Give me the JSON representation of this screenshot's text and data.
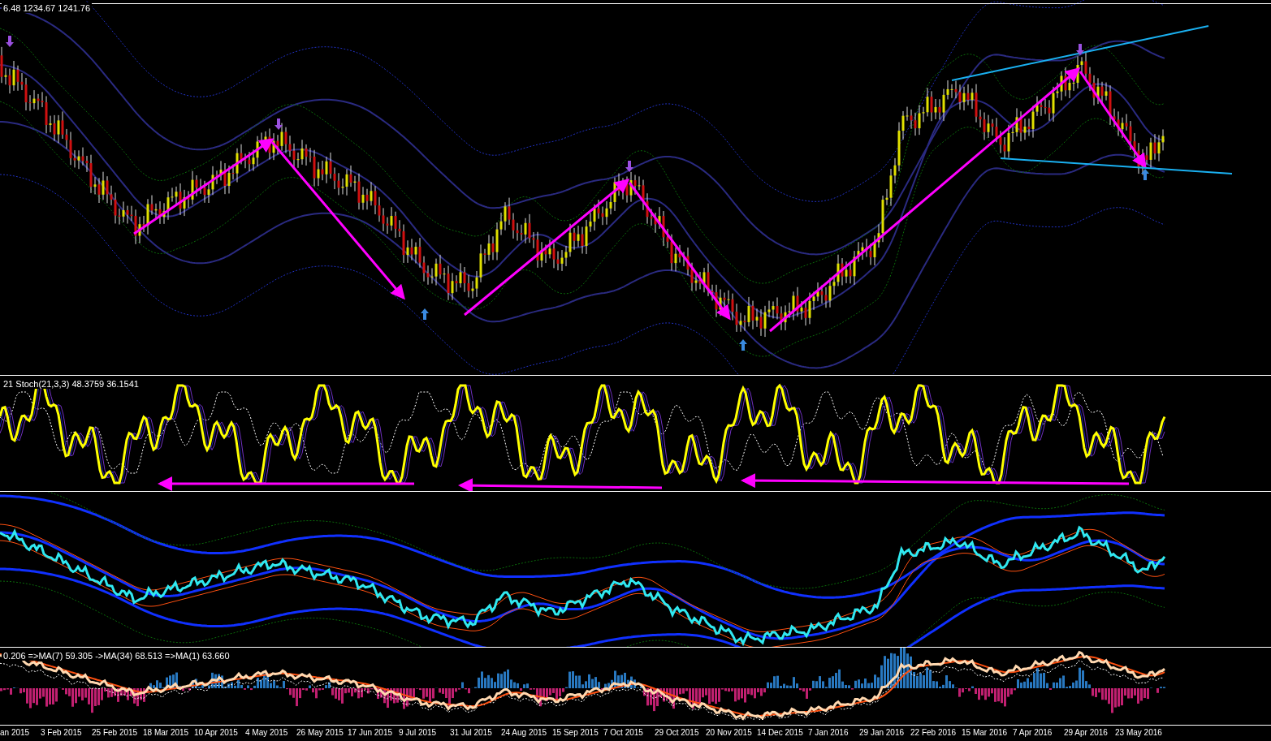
{
  "price_pane": {
    "header": "6.48 1234.67 1241.76"
  },
  "stoch_pane": {
    "header": "21  Stoch(21,3,3) 48.3759 36.1541"
  },
  "macd_pane": {
    "header": "0.206  =>MA(7) 59.305  ->MA(34) 68.513  =>MA(1) 63.660"
  },
  "time_axis": {
    "labels": [
      "an 2015",
      "3 Feb 2015",
      "25 Feb 2015",
      "18 Mar 2015",
      "10 Apr 2015",
      "4 May 2015",
      "26 May 2015",
      "17 Jun 2015",
      "9 Jul 2015",
      "31 Jul 2015",
      "24 Aug 2015",
      "15 Sep 2015",
      "7 Oct 2015",
      "29 Oct 2015",
      "20 Nov 2015",
      "14 Dec 2015",
      "7 Jan 2016",
      "29 Jan 2016",
      "22 Feb 2016",
      "15 Mar 2016",
      "7 Apr 2016",
      "29 Apr 2016",
      "23 May 2016"
    ]
  }
}
